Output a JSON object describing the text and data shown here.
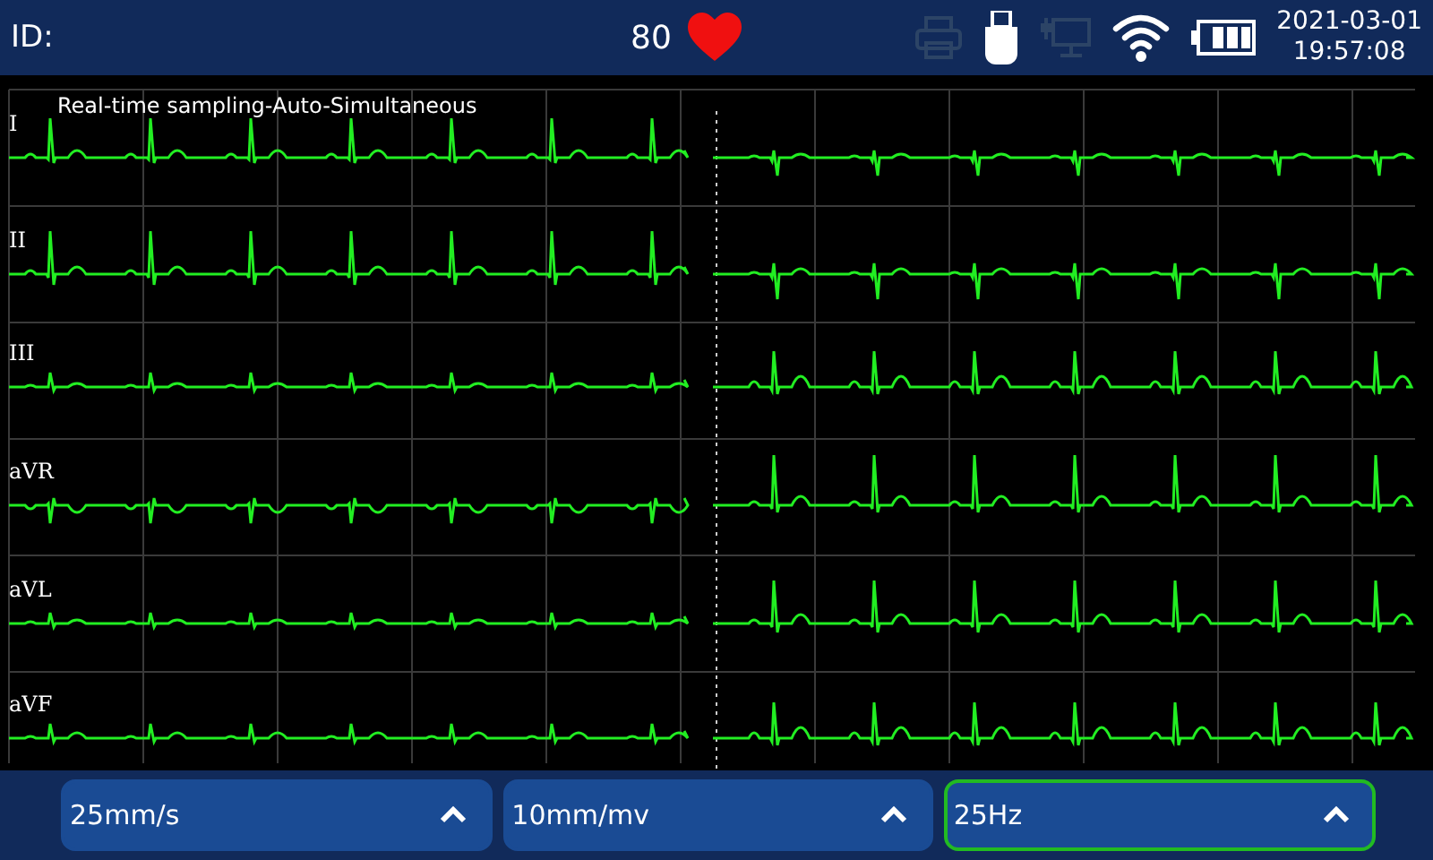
{
  "header": {
    "id_label": "ID:",
    "heart_rate": "80",
    "date": "2021-03-01",
    "time": "19:57:08",
    "status_icons": [
      {
        "kind": "printer",
        "active": false
      },
      {
        "kind": "usb",
        "active": true
      },
      {
        "kind": "network",
        "active": false
      },
      {
        "kind": "wifi",
        "active": true
      },
      {
        "kind": "battery",
        "active": true
      }
    ]
  },
  "ecg": {
    "mode": "Real-time sampling-Auto-Simultaneous",
    "leads": [
      {
        "label": "I"
      },
      {
        "label": "II"
      },
      {
        "label": "III"
      },
      {
        "label": "aVR"
      },
      {
        "label": "aVL"
      },
      {
        "label": "aVF"
      }
    ]
  },
  "settings": [
    {
      "value": "25mm/s",
      "selected": false
    },
    {
      "value": "10mm/mv",
      "selected": false
    },
    {
      "value": "25Hz",
      "selected": true
    }
  ]
}
